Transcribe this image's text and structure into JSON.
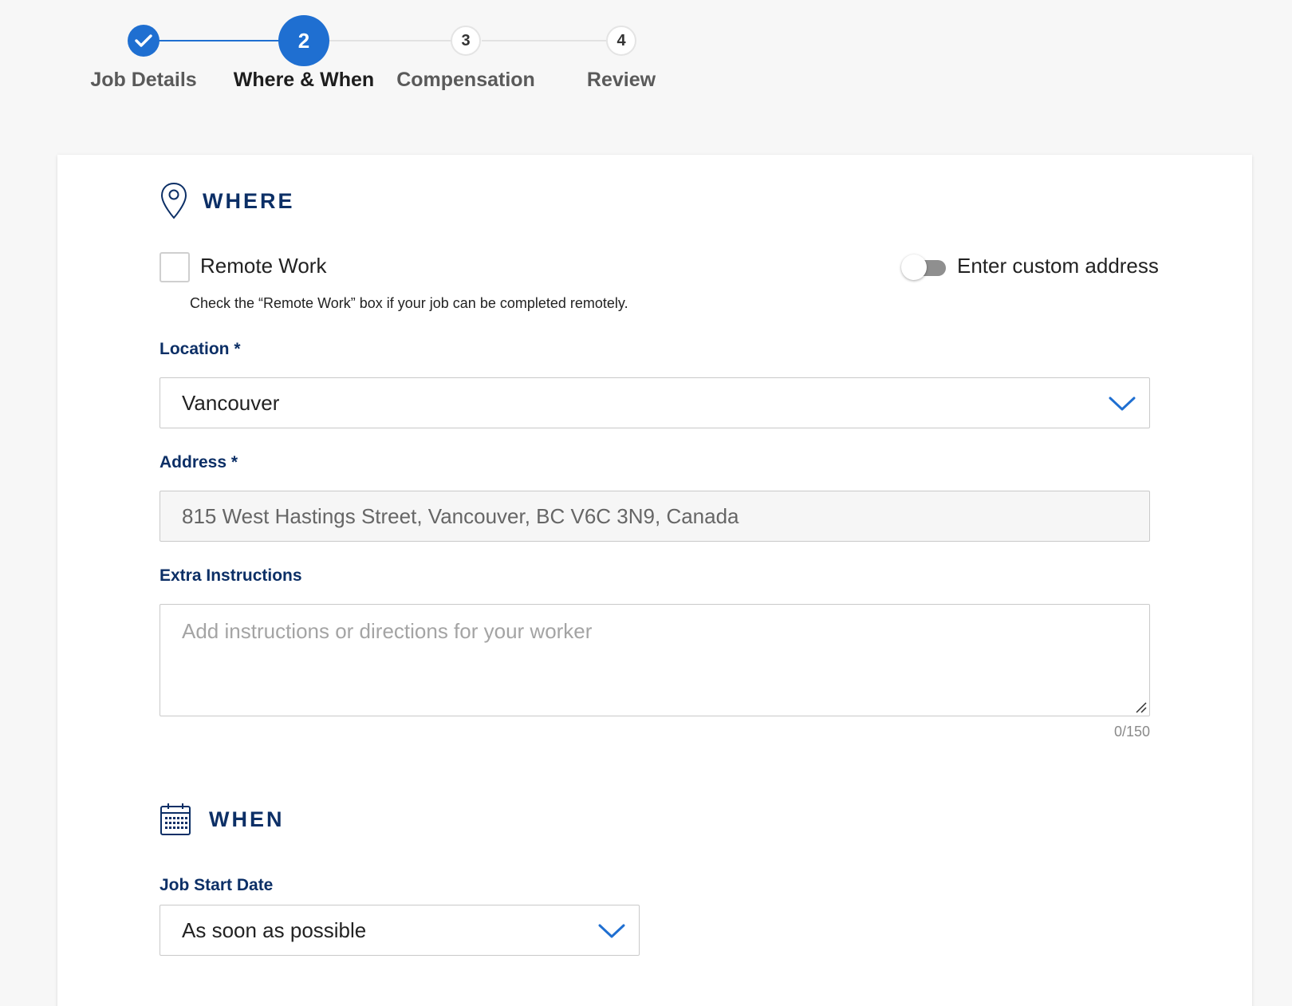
{
  "stepper": {
    "steps": [
      {
        "number": "1",
        "label": "Job Details",
        "state": "done"
      },
      {
        "number": "2",
        "label": "Where & When",
        "state": "current"
      },
      {
        "number": "3",
        "label": "Compensation",
        "state": "todo"
      },
      {
        "number": "4",
        "label": "Review",
        "state": "todo"
      }
    ]
  },
  "where": {
    "title": "WHERE",
    "icon": "location-pin-icon",
    "remote_work": {
      "label": "Remote Work",
      "checked": false
    },
    "help_text": "Check the “Remote Work” box if your job can be completed remotely.",
    "custom_address": {
      "label": "Enter custom address",
      "enabled": false
    },
    "location": {
      "label": "Location *",
      "value": "Vancouver"
    },
    "address": {
      "label": "Address *",
      "value": "815 West Hastings Street, Vancouver, BC V6C 3N9, Canada"
    },
    "extra_instructions": {
      "label": "Extra Instructions",
      "placeholder": "Add instructions or directions for your worker",
      "counter": "0/150"
    }
  },
  "when": {
    "title": "WHEN",
    "icon": "calendar-icon",
    "job_start_date": {
      "label": "Job Start Date",
      "value": "As soon as possible"
    }
  },
  "colors": {
    "accent": "#1f6fd1",
    "heading": "#0c2f66"
  }
}
